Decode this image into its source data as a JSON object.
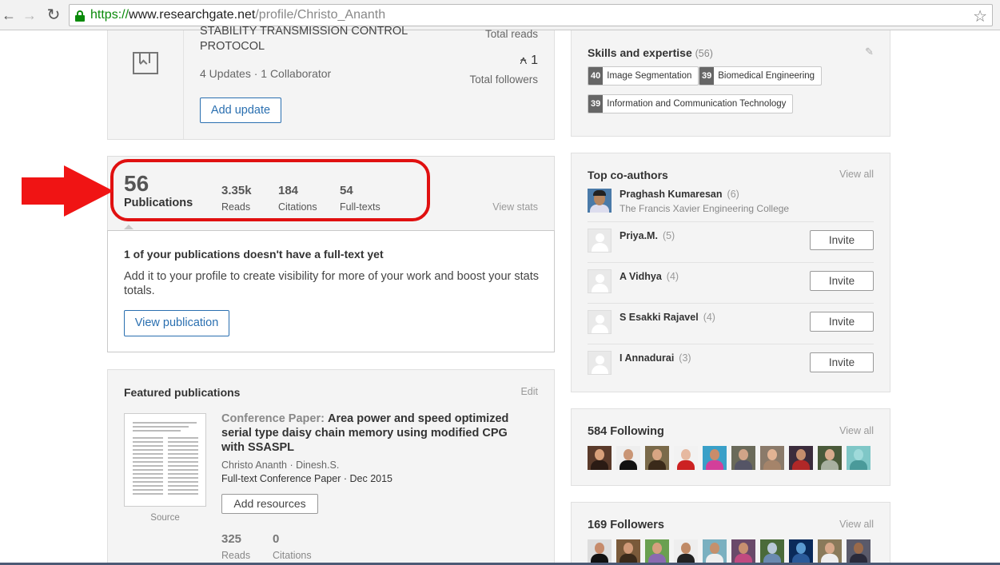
{
  "browser": {
    "url_scheme": "https://",
    "url_host": "www.researchgate.net",
    "url_path": "/profile/Christo_Ananth",
    "back_glyph": "←",
    "forward_glyph": "→",
    "reload_glyph": "↻",
    "star_glyph": "☆"
  },
  "project": {
    "title_line1": "STABILITY TRANSMISSION CONTROL",
    "title_line2": "PROTOCOL",
    "meta": "4 Updates · 1 Collaborator",
    "add_update_label": "Add update",
    "total_reads_label": "Total reads",
    "followers_count": "1",
    "followers_glyph": "⍲",
    "total_followers_label": "Total followers"
  },
  "stats": {
    "publications_count": "56",
    "publications_label": "Publications",
    "reads_value": "3.35k",
    "reads_label": "Reads",
    "citations_value": "184",
    "citations_label": "Citations",
    "fulltexts_value": "54",
    "fulltexts_label": "Full-texts",
    "view_stats_label": "View stats"
  },
  "fulltext_notice": {
    "title": "1 of your publications doesn't have a full-text yet",
    "description": "Add it to your profile to create visibility for more of your work and boost your stats totals.",
    "button_label": "View publication"
  },
  "featured": {
    "title": "Featured publications",
    "edit_label": "Edit",
    "pub_type": "Conference Paper:",
    "pub_title": "Area power and speed optimized serial type daisy chain memory using modified CPG with SSASPL",
    "authors": "Christo Ananth · Dinesh.S.",
    "kind": "Full-text Conference Paper · Dec 2015",
    "add_resources_label": "Add resources",
    "source_label": "Source",
    "reads_value": "325",
    "reads_label": "Reads",
    "citations_value": "0",
    "citations_label": "Citations"
  },
  "skills": {
    "title": "Skills and expertise",
    "count": "(56)",
    "pencil_glyph": "✎",
    "items": [
      {
        "count": "40",
        "label": "Image Segmentation"
      },
      {
        "count": "39",
        "label": "Biomedical Engineering"
      },
      {
        "count": "39",
        "label": "Information and Communication Technology"
      }
    ]
  },
  "coauthors": {
    "title": "Top co-authors",
    "view_all_label": "View all",
    "invite_label": "Invite",
    "items": [
      {
        "name": "Praghash Kumaresan",
        "count": "(6)",
        "institution": "The Francis Xavier Engineering College"
      },
      {
        "name": "Priya.M.",
        "count": "(5)"
      },
      {
        "name": "A Vidhya",
        "count": "(4)"
      },
      {
        "name": "S Esakki Rajavel",
        "count": "(4)"
      },
      {
        "name": "I Annadurai",
        "count": "(3)"
      }
    ]
  },
  "following": {
    "title": "584 Following",
    "view_all_label": "View all"
  },
  "followers": {
    "title": "169 Followers",
    "view_all_label": "View all"
  },
  "colors": {
    "link_blue": "#2a6fb0",
    "annotation_red": "#e01010",
    "secure_green": "#0a8a0a"
  }
}
